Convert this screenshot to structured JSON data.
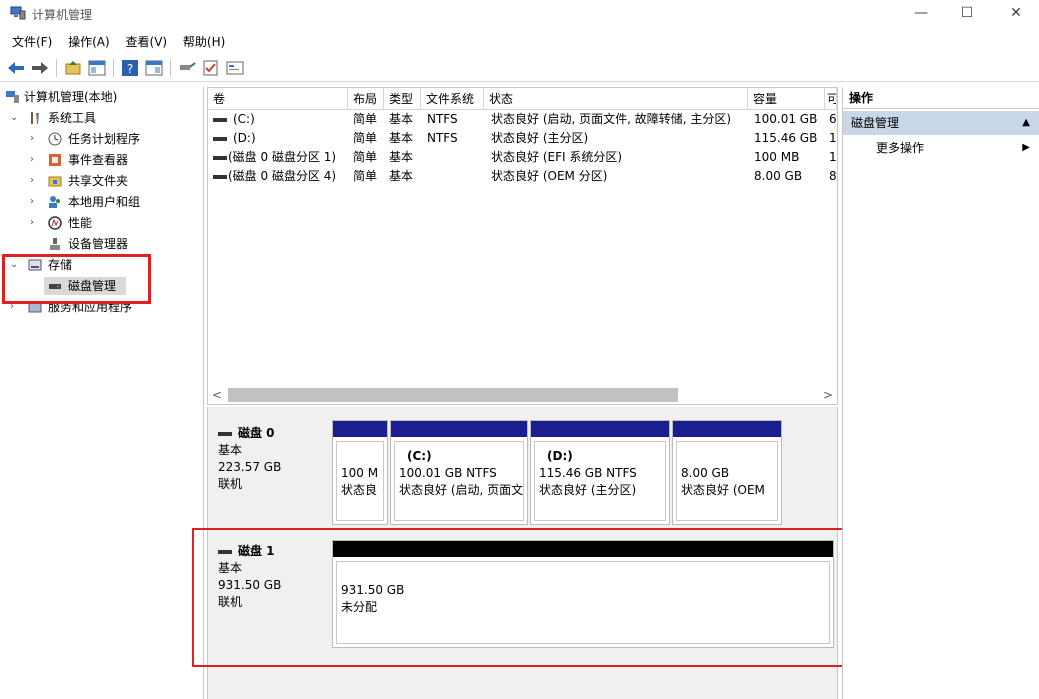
{
  "window": {
    "title": "计算机管理",
    "minimize_glyph": "—",
    "maximize_glyph": "☐",
    "close_glyph": "✕"
  },
  "menu": [
    "文件(F)",
    "操作(A)",
    "查看(V)",
    "帮助(H)"
  ],
  "tree": {
    "root": "计算机管理(本地)",
    "system_tools": "系统工具",
    "task_scheduler": "任务计划程序",
    "event_viewer": "事件查看器",
    "shared_folders": "共享文件夹",
    "local_users": "本地用户和组",
    "performance": "性能",
    "device_manager": "设备管理器",
    "storage": "存储",
    "disk_management": "磁盘管理",
    "services": "服务和应用程序"
  },
  "volume_columns": [
    "卷",
    "布局",
    "类型",
    "文件系统",
    "状态",
    "容量",
    "可"
  ],
  "volumes": [
    {
      "vol": "(C:)",
      "layout": "简单",
      "type": "基本",
      "fs": "NTFS",
      "status": "状态良好 (启动, 页面文件, 故障转储, 主分区)",
      "capacity": "100.01 GB",
      "free": "6"
    },
    {
      "vol": "(D:)",
      "layout": "简单",
      "type": "基本",
      "fs": "NTFS",
      "status": "状态良好 (主分区)",
      "capacity": "115.46 GB",
      "free": "1"
    },
    {
      "vol": "(磁盘 0 磁盘分区 1)",
      "layout": "简单",
      "type": "基本",
      "fs": "",
      "status": "状态良好 (EFI 系统分区)",
      "capacity": "100 MB",
      "free": "1"
    },
    {
      "vol": "(磁盘 0 磁盘分区 4)",
      "layout": "简单",
      "type": "基本",
      "fs": "",
      "status": "状态良好 (OEM 分区)",
      "capacity": "8.00 GB",
      "free": "8"
    }
  ],
  "scroll": {
    "left": "<",
    "right": ">"
  },
  "disks": [
    {
      "name": "磁盘 0",
      "type": "基本",
      "size": "223.57 GB",
      "state": "联机",
      "partitions": [
        {
          "name": "",
          "size_fs": "100 M",
          "status": "状态良"
        },
        {
          "name": "(C:)",
          "size_fs": "100.01 GB NTFS",
          "status": "状态良好 (启动, 页面文"
        },
        {
          "name": "(D:)",
          "size_fs": "115.46 GB NTFS",
          "status": "状态良好 (主分区)"
        },
        {
          "name": "",
          "size_fs": "8.00 GB",
          "status": "状态良好 (OEM"
        }
      ]
    },
    {
      "name": "磁盘 1",
      "type": "基本",
      "size": "931.50 GB",
      "state": "联机",
      "partitions": [
        {
          "name": "",
          "size_fs": "931.50 GB",
          "status": "未分配"
        }
      ]
    }
  ],
  "actions": {
    "header": "操作",
    "section": "磁盘管理",
    "more": "更多操作",
    "caret_up": "▲",
    "caret_right": "▶"
  },
  "colors": {
    "partition_bar": "#1a1e8e",
    "unallocated_bar": "#000000",
    "highlight_box": "#e02020",
    "action_section_bg": "#c9d7e8"
  }
}
